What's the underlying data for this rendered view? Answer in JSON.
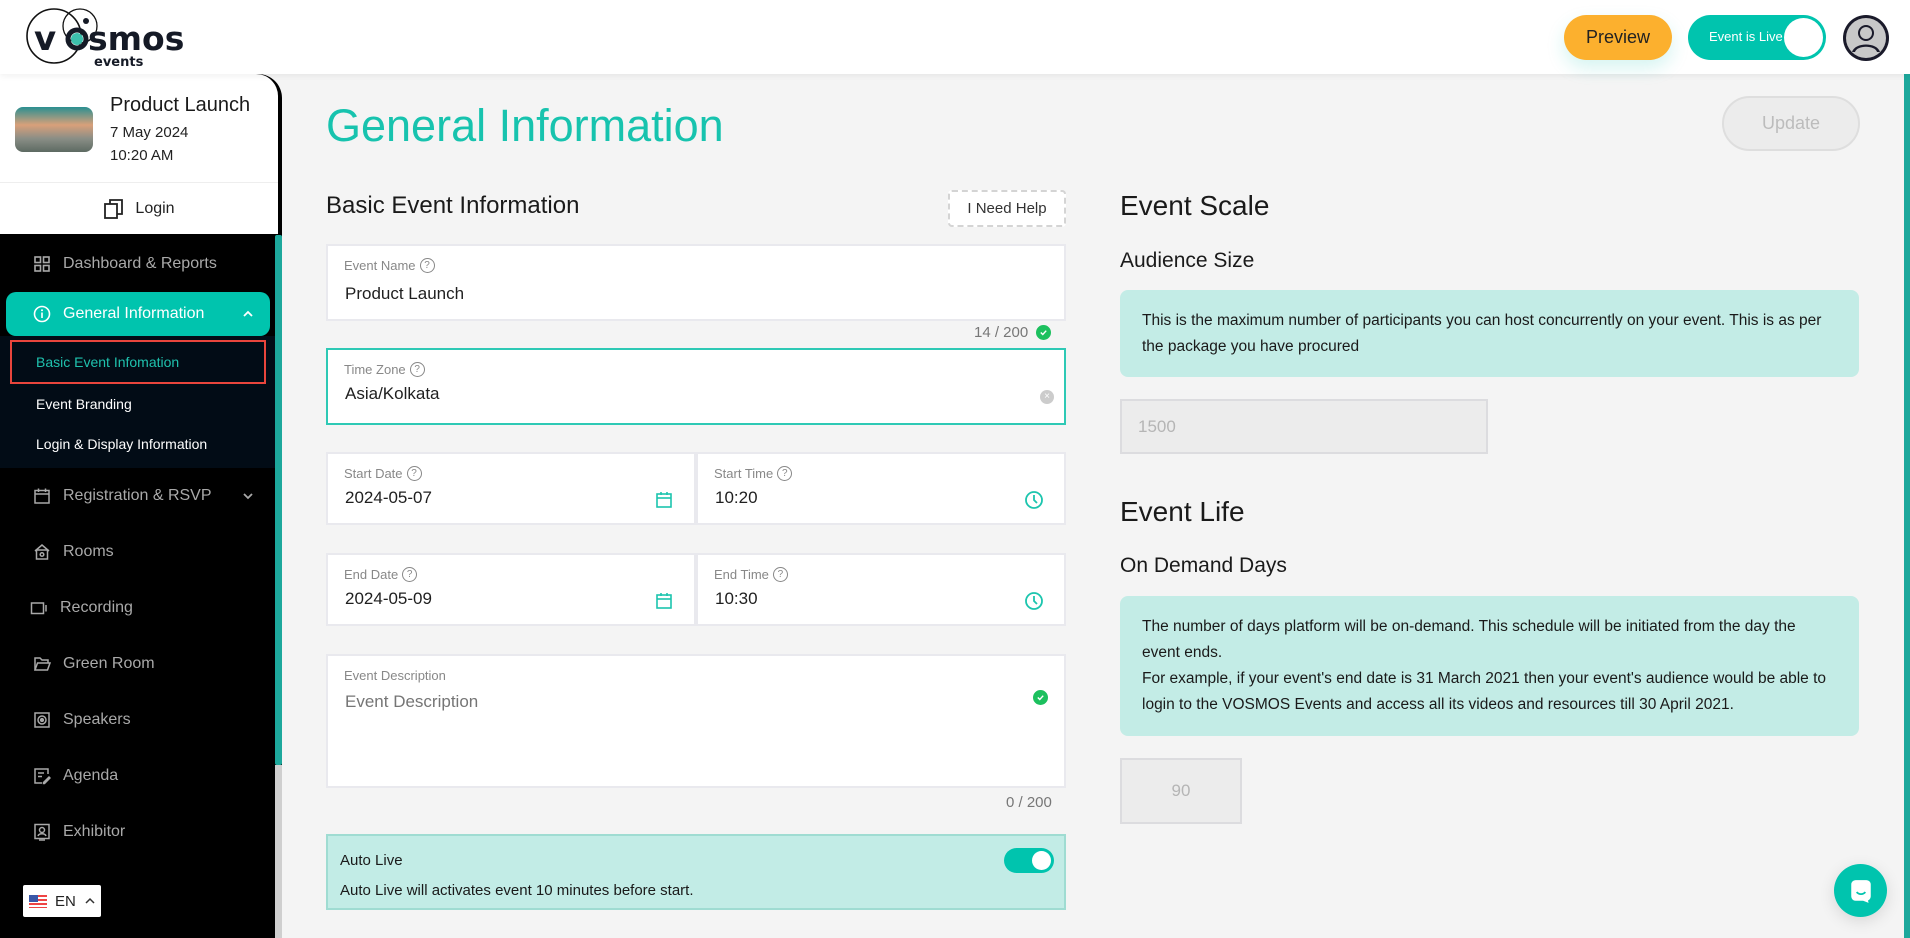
{
  "header": {
    "logo_text": "vosmos",
    "logo_sub": "events",
    "preview_label": "Preview",
    "live_toggle_label": "Event is Live",
    "live_toggle_on": true
  },
  "event": {
    "title": "Product Launch",
    "date": "7 May 2024",
    "time": "10:20 AM",
    "login_label": "Login"
  },
  "sidebar": {
    "items": [
      {
        "label": "Dashboard & Reports",
        "icon": "grid-icon"
      },
      {
        "label": "General Information",
        "icon": "info-circle-icon",
        "active": true,
        "expanded": true
      },
      {
        "label": "Registration & RSVP",
        "icon": "calendar-icon",
        "has_children": true
      },
      {
        "label": "Rooms",
        "icon": "home-icon"
      },
      {
        "label": "Recording",
        "icon": "video-camera-icon"
      },
      {
        "label": "Green Room",
        "icon": "folder-open-icon"
      },
      {
        "label": "Speakers",
        "icon": "speaker-icon"
      },
      {
        "label": "Agenda",
        "icon": "edit-list-icon"
      },
      {
        "label": "Exhibitor",
        "icon": "id-badge-icon"
      }
    ],
    "sub_items": [
      {
        "label": "Basic Event Infomation",
        "selected": true
      },
      {
        "label": "Event Branding"
      },
      {
        "label": "Login & Display Information"
      }
    ],
    "language": "EN"
  },
  "main": {
    "title": "General Information",
    "update_label": "Update",
    "basic": {
      "title": "Basic Event Information",
      "help_label": "I Need Help",
      "event_name_label": "Event Name",
      "event_name_value": "Product Launch",
      "event_name_counter": "14 / 200",
      "timezone_label": "Time Zone",
      "timezone_value": "Asia/Kolkata",
      "start_date_label": "Start Date",
      "start_date_value": "2024-05-07",
      "start_time_label": "Start Time",
      "start_time_value": "10:20",
      "end_date_label": "End Date",
      "end_date_value": "2024-05-09",
      "end_time_label": "End Time",
      "end_time_value": "10:30",
      "description_label": "Event Description",
      "description_placeholder": "Event Description",
      "description_value": "",
      "description_counter": "0 / 200",
      "auto_live_title": "Auto Live",
      "auto_live_desc": "Auto Live will activates event 10 minutes before start.",
      "auto_live_on": true
    },
    "scale": {
      "title": "Event Scale",
      "audience_title": "Audience Size",
      "audience_info": "This is the maximum number of participants you can host concurrently on your event. This is as per the package you have procured",
      "audience_value": "1500"
    },
    "life": {
      "title": "Event Life",
      "on_demand_title": "On Demand Days",
      "info_line1": "The number of days platform will be on-demand. This schedule will be initiated from the day the event ends.",
      "info_line2": "For example, if your event's end date is 31 March 2021 then your event's audience would be able to login to the VOSMOS Events and access all its videos and resources till 30 April 2021.",
      "on_demand_value": "90"
    }
  },
  "colors": {
    "accent": "#00c4ae",
    "preview": "#fcb02e",
    "sidebar_bg": "#000000",
    "info_bg": "#c3ece6",
    "selected_outline": "#e8453c"
  }
}
